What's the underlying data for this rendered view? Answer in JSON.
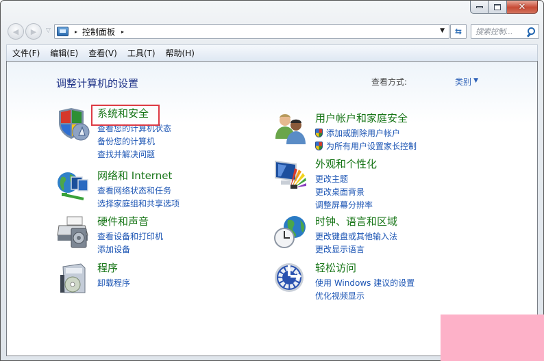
{
  "window": {
    "controls": {
      "minimize": "–",
      "maximize": "□",
      "close": "✕"
    }
  },
  "navbar": {
    "back_glyph": "◀",
    "forward_glyph": "▶",
    "history_glyph": "▽",
    "breadcrumb": [
      {
        "label": "控制面板"
      }
    ],
    "crumb_separator": "▸",
    "dropdown_glyph": "▼",
    "refresh_glyph": "⇆",
    "search_placeholder": "搜索控制..."
  },
  "menubar": {
    "items": [
      {
        "label": "文件(F)"
      },
      {
        "label": "编辑(E)"
      },
      {
        "label": "查看(V)"
      },
      {
        "label": "工具(T)"
      },
      {
        "label": "帮助(H)"
      }
    ]
  },
  "main": {
    "heading": "调整计算机的设置",
    "view_by_label": "查看方式:",
    "view_by_value": "类别",
    "view_by_arrow": "▼",
    "categories": [
      {
        "title": "系统和安全",
        "icon": "security-shield-icon",
        "highlighted": true,
        "links": [
          {
            "label": "查看您的计算机状态"
          },
          {
            "label": "备份您的计算机"
          },
          {
            "label": "查找并解决问题"
          }
        ]
      },
      {
        "title": "网络和 Internet",
        "icon": "network-globe-icon",
        "links": [
          {
            "label": "查看网络状态和任务"
          },
          {
            "label": "选择家庭组和共享选项"
          }
        ]
      },
      {
        "title": "硬件和声音",
        "icon": "printer-speaker-icon",
        "links": [
          {
            "label": "查看设备和打印机"
          },
          {
            "label": "添加设备"
          }
        ]
      },
      {
        "title": "程序",
        "icon": "programs-disc-icon",
        "links": [
          {
            "label": "卸载程序"
          }
        ]
      },
      {
        "title": "用户帐户和家庭安全",
        "icon": "users-icon",
        "links": [
          {
            "label": "添加或删除用户帐户",
            "shield": true
          },
          {
            "label": "为所有用户设置家长控制",
            "shield": true
          }
        ]
      },
      {
        "title": "外观和个性化",
        "icon": "appearance-palette-icon",
        "links": [
          {
            "label": "更改主题"
          },
          {
            "label": "更改桌面背景"
          },
          {
            "label": "调整屏幕分辨率"
          }
        ]
      },
      {
        "title": "时钟、语言和区域",
        "icon": "clock-globe-icon",
        "links": [
          {
            "label": "更改键盘或其他输入法"
          },
          {
            "label": "更改显示语言"
          }
        ]
      },
      {
        "title": "轻松访问",
        "icon": "ease-of-access-icon",
        "links": [
          {
            "label": "使用 Windows 建议的设置"
          },
          {
            "label": "优化视频显示"
          }
        ]
      }
    ]
  },
  "colors": {
    "category_title": "#177517",
    "link": "#1c55b4",
    "heading": "#1e3287",
    "highlight_box": "#dd3a44",
    "overlay_pink": "#fdb1c8"
  }
}
